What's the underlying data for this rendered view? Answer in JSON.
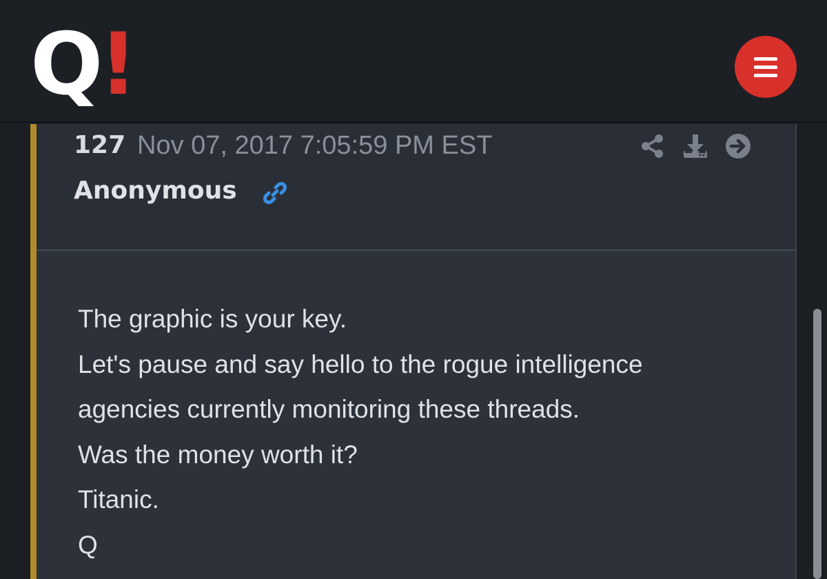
{
  "header": {
    "logo": {
      "letter": "Q",
      "mark": "!"
    },
    "menu_icon": "hamburger-menu-icon",
    "colors": {
      "logo_mark": "#d8302a",
      "menu_button": "#d8302a"
    }
  },
  "post": {
    "number": "127",
    "timestamp": "Nov 07, 2017 7:05:59 PM EST",
    "author": "Anonymous",
    "icons": [
      "share-icon",
      "download-icon",
      "arrow-right-circle-icon",
      "link-icon"
    ],
    "accent_color": "#b18a2c",
    "link_color": "#3a8ee0",
    "body_lines": [
      "The graphic is your key.",
      "Let's pause and say hello to the rogue intelligence",
      "agencies currently monitoring these threads.",
      "Was the money worth it?",
      "Titanic.",
      "Q"
    ]
  }
}
